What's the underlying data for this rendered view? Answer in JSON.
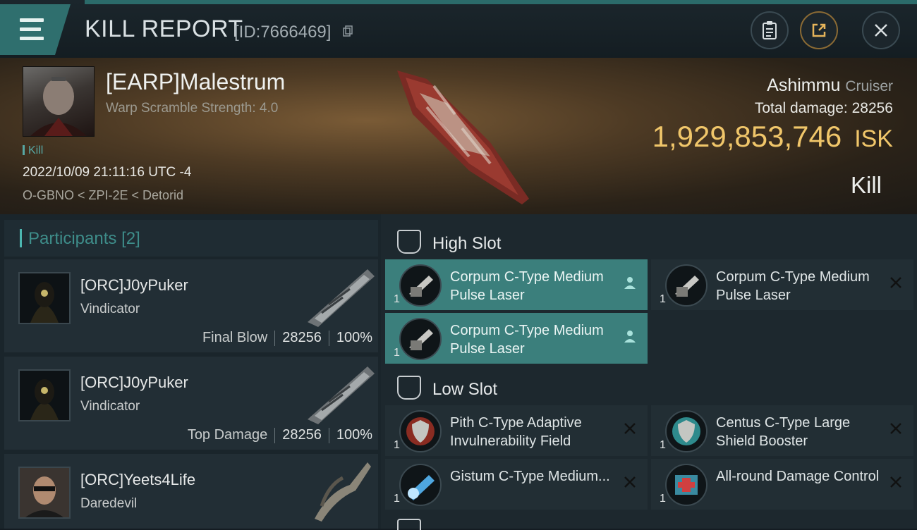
{
  "header": {
    "title": "KILL REPORT",
    "report_id": "[ID:7666469]"
  },
  "victim": {
    "name": "[EARP]Malestrum",
    "warp_scramble": "Warp Scramble Strength: 4.0",
    "tag": "Kill",
    "datetime": "2022/10/09 21:11:16 UTC -4",
    "location": "O-GBNO < ZPI-2E < Detorid",
    "ship_name": "Ashimmu",
    "ship_class": "Cruiser",
    "total_damage_label": "Total damage:",
    "total_damage": "28256",
    "isk_value": "1,929,853,746",
    "isk_currency": "ISK",
    "kill_label": "Kill"
  },
  "participants": {
    "title": "Participants",
    "count": "[2]",
    "items": [
      {
        "name": "[ORC]J0yPuker",
        "ship": "Vindicator",
        "role": "Final Blow",
        "damage": "28256",
        "percent": "100%"
      },
      {
        "name": "[ORC]J0yPuker",
        "ship": "Vindicator",
        "role": "Top Damage",
        "damage": "28256",
        "percent": "100%"
      },
      {
        "name": "[ORC]Yeets4Life",
        "ship": "Daredevil"
      }
    ]
  },
  "slots": {
    "high": {
      "title": "High Slot",
      "modules": [
        {
          "name": "Corpum C-Type Medium Pulse Laser",
          "qty": "1"
        },
        {
          "name": "Corpum C-Type Medium Pulse Laser",
          "qty": "1"
        },
        {
          "name": "Corpum C-Type Medium Pulse Laser",
          "qty": "1"
        }
      ]
    },
    "low": {
      "title": "Low Slot",
      "modules": [
        {
          "name": "Pith C-Type Adaptive Invulnerability Field",
          "qty": "1"
        },
        {
          "name": "Centus C-Type Large Shield Booster",
          "qty": "1"
        },
        {
          "name": "Gistum C-Type Medium...",
          "qty": "1"
        },
        {
          "name": "All-round Damage Control",
          "qty": "1"
        }
      ]
    }
  },
  "icons": {
    "menu": "hamburger-menu-icon",
    "copy": "copy-icon",
    "clipboard": "clipboard-icon",
    "share": "share-icon",
    "close": "close-icon",
    "dropped": "person-icon",
    "destroyed": "x-icon"
  },
  "colors": {
    "accent": "#3b7f7c",
    "isk": "#f0c66a",
    "participant_title": "#3e8d8a"
  }
}
